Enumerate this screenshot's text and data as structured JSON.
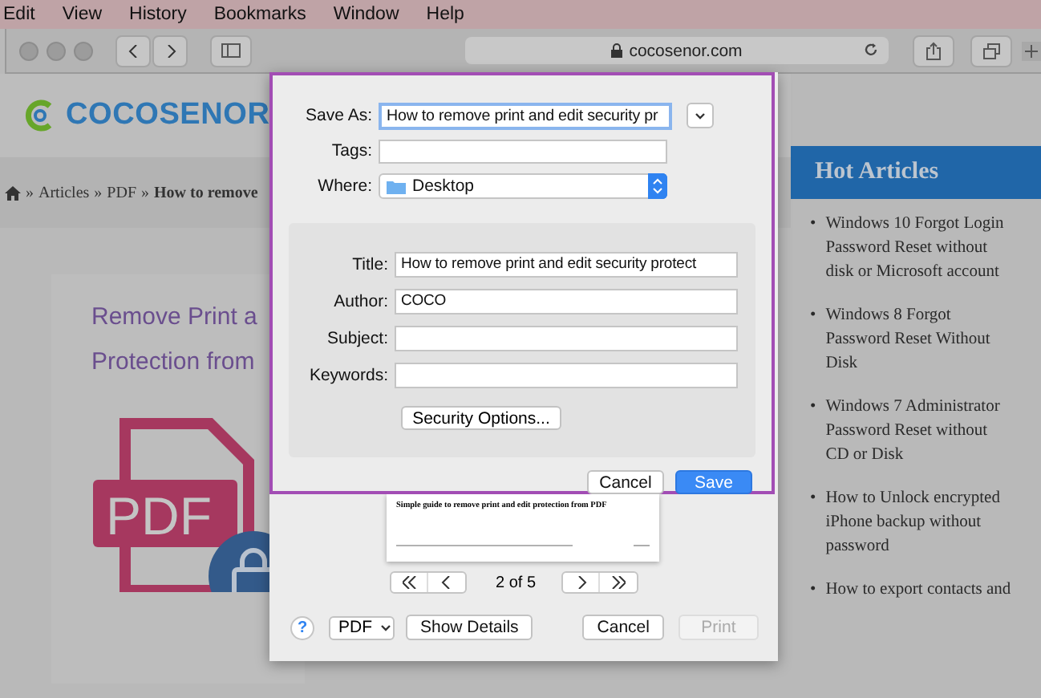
{
  "menu_bar": {
    "items": [
      "Edit",
      "View",
      "History",
      "Bookmarks",
      "Window",
      "Help"
    ]
  },
  "browser": {
    "address": "cocosenor.com"
  },
  "page": {
    "logo": "COCOSENOR",
    "breadcrumb": [
      {
        "kind": "home"
      },
      {
        "kind": "sep",
        "text": "»"
      },
      {
        "kind": "link",
        "text": "Articles"
      },
      {
        "kind": "sep",
        "text": "»"
      },
      {
        "kind": "link",
        "text": "PDF"
      },
      {
        "kind": "sep",
        "text": "»"
      },
      {
        "kind": "current",
        "text": "How to remove"
      }
    ],
    "banner": {
      "lines": [
        "Remove Print a",
        "Protection from"
      ],
      "icon_label": "PDF"
    }
  },
  "sidebar": {
    "title": "Hot Articles",
    "items": [
      {
        "bullet": "•",
        "text": "Windows 10 Forgot Login Password Reset without disk or Microsoft account"
      },
      {
        "bullet": "•",
        "text": "Windows 8 Forgot Password Reset Without Disk"
      },
      {
        "bullet": "•",
        "text": "Windows 7 Administrator Password Reset without CD or Disk"
      },
      {
        "bullet": "•",
        "text": "How to Unlock encrypted iPhone backup without password"
      },
      {
        "bullet": "•",
        "text": "How to export contacts and"
      }
    ]
  },
  "save_sheet": {
    "save_as": {
      "label": "Save As:",
      "value": "How to remove print and edit security pr"
    },
    "tags": {
      "label": "Tags:"
    },
    "where": {
      "label": "Where:",
      "value": "Desktop"
    },
    "fields": [
      {
        "label": "Title:",
        "value": "How to remove print and edit security protect"
      },
      {
        "label": "Author:",
        "value": "COCO"
      },
      {
        "label": "Subject:"
      },
      {
        "label": "Keywords:"
      }
    ],
    "security_button": "Security Options...",
    "buttons": [
      {
        "label": "Cancel",
        "default": false
      },
      {
        "label": "Save",
        "default": true
      }
    ]
  },
  "print_dialog": {
    "preview": {
      "heading": "Simple guide to remove print and edit protection from PDF"
    },
    "page_reading": "2 of 5",
    "help": "?",
    "pdf_menu": "PDF",
    "buttons": [
      {
        "label": "Show Details",
        "disabled": false
      },
      {
        "label": "Cancel",
        "disabled": false
      },
      {
        "label": "Print",
        "disabled": true
      }
    ]
  }
}
